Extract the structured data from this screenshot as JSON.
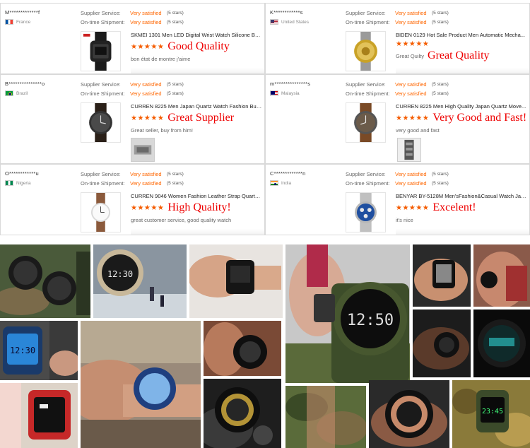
{
  "labels": {
    "supplier_service": "Supplier Service:",
    "ontime_shipment": "On-time Shipment:"
  },
  "reviews": [
    {
      "buyer": "M*************f",
      "country": "France",
      "flag": "france-flag",
      "supplier_value": "Very satisfied",
      "supplier_stars": "(5 stars)",
      "shipment_value": "Very satisfied",
      "shipment_stars": "(5 stars)",
      "product": "SKMEI 1301 Men LED Digital Wrist Watch Silicone Ba...",
      "stars": "★★★★★",
      "headline": "Good Quality",
      "comment": "bon état de montre j'aime"
    },
    {
      "buyer": "K************s",
      "country": "United States",
      "flag": "usa-flag",
      "supplier_value": "Very satisfied",
      "supplier_stars": "(5 stars)",
      "shipment_value": "Very satisfied",
      "shipment_stars": "(5 stars)",
      "product": "BIDEN 0129 Hot Sale Product Men Automatic Mecha...",
      "stars": "★★★★★",
      "prefix": "Great Quilty",
      "headline": "Great Quality",
      "comment": ""
    },
    {
      "buyer": "B***************o",
      "country": "Brazil",
      "flag": "brazil-flag",
      "supplier_value": "Very satisfied",
      "supplier_stars": "(5 stars)",
      "shipment_value": "Very satisfied",
      "shipment_stars": "(5 stars)",
      "product": "CURREN 8225 Men Japan Quartz Watch Fashion Busi...",
      "stars": "★★★★★",
      "headline": "Great Supplier",
      "comment": "Great seller, buy from him!"
    },
    {
      "buyer": "m***************s",
      "country": "Malaysia",
      "flag": "malaysia-flag",
      "supplier_value": "Very satisfied",
      "supplier_stars": "(5 stars)",
      "shipment_value": "Very satisfied",
      "shipment_stars": "(5 stars)",
      "product": "CURREN 8225 Men High Quality Japan Quartz Move...",
      "stars": "★★★★★",
      "headline": "Very Good and Fast!",
      "comment": "very good and fast"
    },
    {
      "buyer": "O************u",
      "country": "Nigeria",
      "flag": "nigeria-flag",
      "supplier_value": "Very satisfied",
      "supplier_stars": "(5 stars)",
      "shipment_value": "Very satisfied",
      "shipment_stars": "(5 stars)",
      "product": "CURREN 9046 Women Fashion Leather Strap Quartz ...",
      "stars": "★★★★★",
      "headline": "High Quality!",
      "comment": "great customer service, good quality watch"
    },
    {
      "buyer": "C*************n",
      "country": "India",
      "flag": "india-flag",
      "supplier_value": "Very satisfied",
      "supplier_stars": "(5 stars)",
      "shipment_value": "Very satisfied",
      "shipment_stars": "(5 stars)",
      "product": "BENYAR BY-5128M Men'sFashion&Casual Watch Jap...",
      "stars": "★★★★★",
      "headline": "Excelent!",
      "comment": "it's nice"
    }
  ],
  "colors": {
    "satisfied": "#ff6600",
    "headline": "#e00000",
    "stars": "#f55c00"
  },
  "collage": {
    "watch_face_text": {
      "p1": "12:30",
      "p4": "12:50",
      "p5": "12:30",
      "p14": "23:45"
    }
  }
}
